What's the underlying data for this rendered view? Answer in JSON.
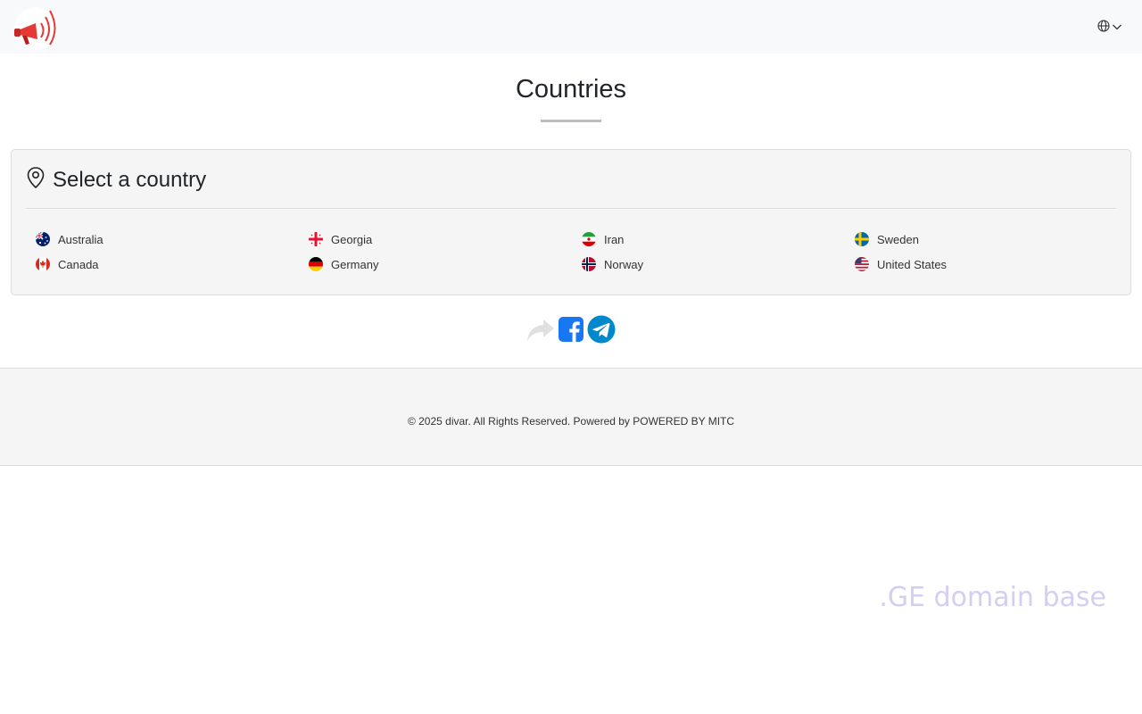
{
  "header": {
    "logo_icon": "megaphone-icon",
    "language_icon": "globe-icon",
    "language_chevron_icon": "chevron-down-icon"
  },
  "page": {
    "title": "Countries"
  },
  "card": {
    "icon": "map-pin-icon",
    "title": "Select a country",
    "countries": [
      {
        "name": "Australia",
        "flag_icon": "flag-australia-icon"
      },
      {
        "name": "Georgia",
        "flag_icon": "flag-georgia-icon"
      },
      {
        "name": "Iran",
        "flag_icon": "flag-iran-icon"
      },
      {
        "name": "Sweden",
        "flag_icon": "flag-sweden-icon"
      },
      {
        "name": "Canada",
        "flag_icon": "flag-canada-icon"
      },
      {
        "name": "Germany",
        "flag_icon": "flag-germany-icon"
      },
      {
        "name": "Norway",
        "flag_icon": "flag-norway-icon"
      },
      {
        "name": "United States",
        "flag_icon": "flag-united-states-icon"
      }
    ]
  },
  "share": {
    "items": [
      {
        "icon": "share-arrow-icon",
        "color": "#e0e0e0"
      },
      {
        "icon": "facebook-icon",
        "color": "#1877f2"
      },
      {
        "icon": "telegram-icon",
        "color": "#0088cc"
      }
    ]
  },
  "footer": {
    "text": "© 2025 divar. All Rights Reserved. Powered by POWERED BY MITC"
  },
  "watermark": {
    "text": ".GE domain base",
    "color": "#d6cdf2"
  },
  "colors": {
    "topbar_bg": "#f8f9fa",
    "card_bg": "#f5f5f5",
    "accent_red": "#e53935"
  }
}
